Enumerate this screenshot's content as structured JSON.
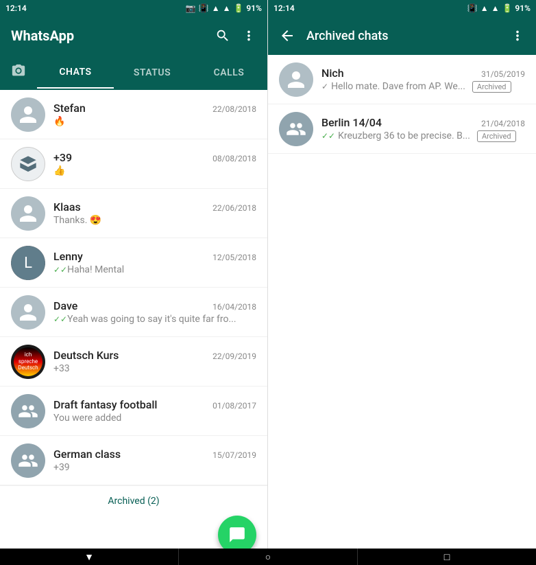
{
  "leftPanel": {
    "statusBar": {
      "time": "12:14",
      "battery": "91%"
    },
    "appBar": {
      "title": "WhatsApp",
      "searchLabel": "search",
      "menuLabel": "more options"
    },
    "tabs": [
      {
        "id": "camera",
        "label": "📷",
        "isIcon": true
      },
      {
        "id": "chats",
        "label": "CHATS",
        "active": true
      },
      {
        "id": "status",
        "label": "STATUS",
        "active": false
      },
      {
        "id": "calls",
        "label": "CALLS",
        "active": false
      }
    ],
    "chats": [
      {
        "name": "Stefan",
        "preview": "🔥",
        "date": "22/08/2018",
        "avatarType": "person",
        "hasCheck": false
      },
      {
        "name": "+39",
        "preview": "👍",
        "date": "08/08/2018",
        "avatarType": "custom-triangle",
        "hasCheck": false
      },
      {
        "name": "Klaas",
        "preview": "Thanks. 😍",
        "date": "22/06/2018",
        "avatarType": "person",
        "hasCheck": false
      },
      {
        "name": "Lenny",
        "preview": "✓✓Haha! Mental",
        "date": "12/05/2018",
        "avatarType": "photo",
        "hasCheck": true
      },
      {
        "name": "Dave",
        "preview": "✓✓Yeah was going to say it's quite far fro...",
        "date": "16/04/2018",
        "avatarType": "person",
        "hasCheck": true
      },
      {
        "name": "Deutsch Kurs",
        "preview": "+33",
        "date": "22/09/2019",
        "avatarType": "deutsch",
        "hasCheck": false,
        "isGroup": false
      },
      {
        "name": "Draft fantasy football",
        "preview": "You were added",
        "date": "01/08/2017",
        "avatarType": "group",
        "hasCheck": false
      },
      {
        "name": "German class",
        "preview": "+39",
        "date": "15/07/2019",
        "avatarType": "group",
        "hasCheck": false
      }
    ],
    "archivedLabel": "Archived (2)",
    "fabIcon": "💬"
  },
  "rightPanel": {
    "statusBar": {
      "time": "12:14",
      "battery": "91%"
    },
    "appBar": {
      "title": "Archived chats",
      "backLabel": "back",
      "menuLabel": "more options"
    },
    "archivedChats": [
      {
        "name": "Nich",
        "preview": "✓ Hello mate. Dave from AP. We...",
        "date": "31/05/2019",
        "avatarType": "person",
        "badge": "Archived"
      },
      {
        "name": "Berlin 14/04",
        "preview": "✓✓ Kreuzberg 36 to be precise. B...",
        "date": "21/04/2018",
        "avatarType": "group",
        "badge": "Archived"
      }
    ]
  }
}
